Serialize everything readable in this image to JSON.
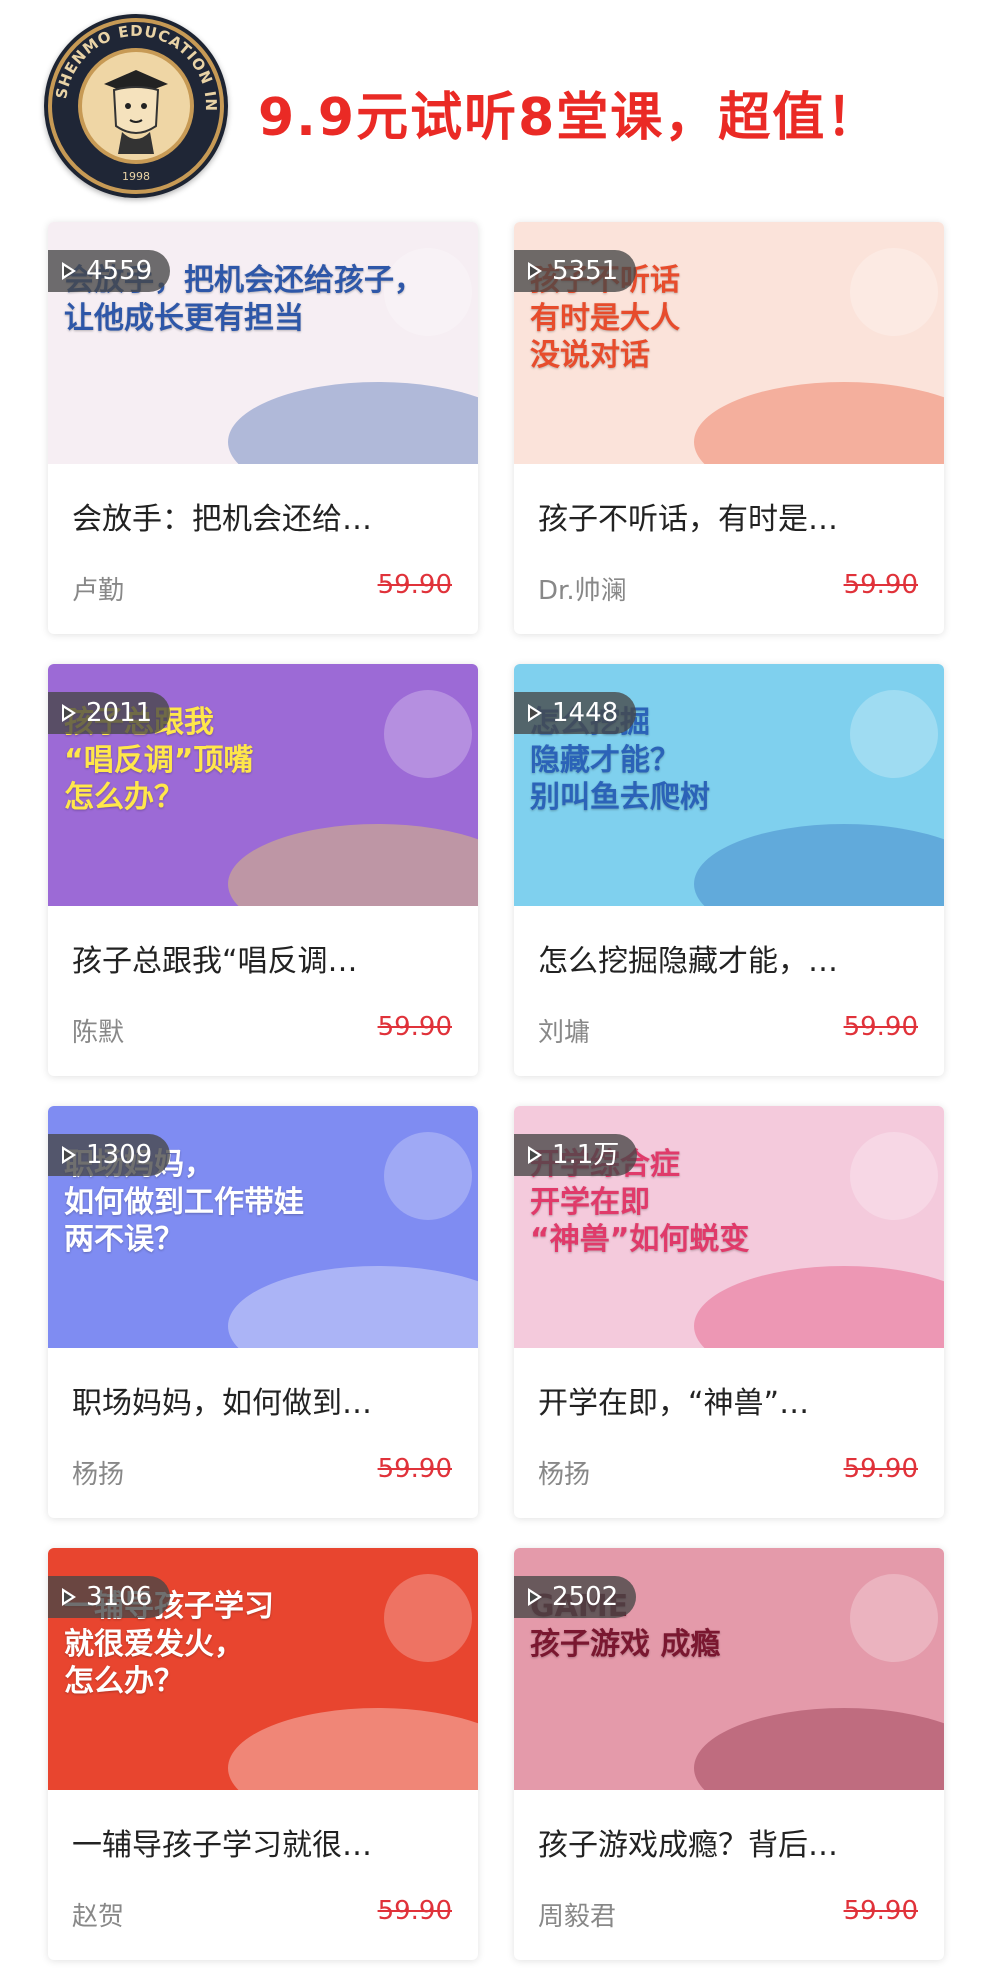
{
  "header": {
    "logo_text": "SHENMO EDUCATION INT.",
    "logo_year": "1998",
    "headline": "9.9元试听8堂课，超值！"
  },
  "courses": [
    {
      "count": "4559",
      "thumb_text": "会放手，把机会还给孩子，\n让他成长更有担当",
      "title": "会放手：把机会还给…",
      "author": "卢勤",
      "price": "59.90",
      "bg": "#f6eef3",
      "accent": "#2e57a8"
    },
    {
      "count": "5351",
      "thumb_text": "孩子不听话\n有时是大人\n没说对话",
      "title": "孩子不听话，有时是…",
      "author": "Dr.帅澜",
      "price": "59.90",
      "bg": "#fbe3da",
      "accent": "#e74c2c"
    },
    {
      "count": "2011",
      "thumb_text": "孩子总跟我\n“唱反调”顶嘴\n怎么办？",
      "title": "孩子总跟我“唱反调…",
      "author": "陈默",
      "price": "59.90",
      "bg": "#9c6ad6",
      "accent": "#ffe74a"
    },
    {
      "count": "1448",
      "thumb_text": "怎么挖掘\n隐藏才能？\n别叫鱼去爬树",
      "title": "怎么挖掘隐藏才能，…",
      "author": "刘墉",
      "price": "59.90",
      "bg": "#7fd0ee",
      "accent": "#2b63b8"
    },
    {
      "count": "1309",
      "thumb_text": "职场妈妈，\n如何做到工作带娃\n两不误？",
      "title": "职场妈妈，如何做到…",
      "author": "杨扬",
      "price": "59.90",
      "bg": "#7f8cf2",
      "accent": "#ffffff"
    },
    {
      "count": "1.1万",
      "thumb_text": "开学综合症\n开学在即\n“神兽”如何蜕变",
      "title": "开学在即，“神兽”…",
      "author": "杨扬",
      "price": "59.90",
      "bg": "#f4cadc",
      "accent": "#e03a6a"
    },
    {
      "count": "3106",
      "thumb_text": "一辅导孩子学习\n就很爱发火，\n怎么办？",
      "title": "一辅导孩子学习就很…",
      "author": "赵贺",
      "price": "59.90",
      "bg": "#e8452f",
      "accent": "#ffffff"
    },
    {
      "count": "2502",
      "thumb_text": "GAME\n孩子游戏 成瘾",
      "title": "孩子游戏成瘾？背后…",
      "author": "周毅君",
      "price": "59.90",
      "bg": "#e49aaa",
      "accent": "#7a1730"
    }
  ]
}
